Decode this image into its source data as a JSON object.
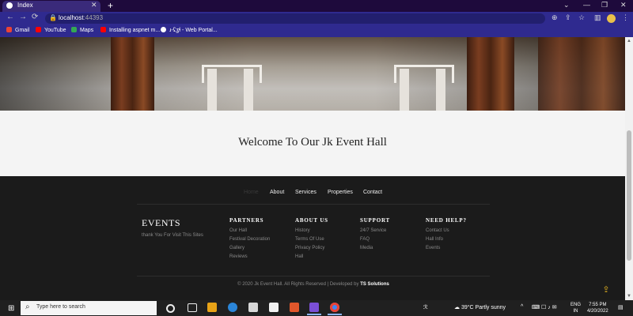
{
  "browser": {
    "tab_title": "Index",
    "tab_close": "✕",
    "new_tab": "+",
    "url_host": "localhost",
    "url_port": ":44393",
    "controls": [
      "⌄",
      "—",
      "❐",
      "✕"
    ],
    "nav": [
      "←",
      "→",
      "⟳"
    ],
    "bookmarks": [
      {
        "label": "Gmail",
        "color": "#ea4335"
      },
      {
        "label": "YouTube",
        "color": "#ff0000"
      },
      {
        "label": "Maps",
        "color": "#34a853"
      },
      {
        "label": "Installing aspnet m...",
        "color": "#ff0000"
      },
      {
        "label": "ɹ-ʢʓɬ - Web Portal...",
        "color": "#ffffff"
      }
    ]
  },
  "page": {
    "welcome": "Welcome To Our Jk Event Hall",
    "nav": [
      "Home",
      "About",
      "Services",
      "Properties",
      "Contact"
    ],
    "brand": "EVENTS",
    "tagline": "thank You For Visit This Sites",
    "columns": [
      {
        "title": "PARTNERS",
        "links": [
          "Our Hall",
          "Festival Decoration",
          "Gallery",
          "Reviews"
        ]
      },
      {
        "title": "ABOUT US",
        "links": [
          "History",
          "Terms Of Use",
          "Privacy Policy",
          "Hall"
        ]
      },
      {
        "title": "SUPPORT",
        "links": [
          "24/7 Service",
          "FAQ",
          "Media"
        ]
      },
      {
        "title": "NEED HELP?",
        "links": [
          "Contact Us",
          "Hall Info",
          "Events"
        ]
      }
    ],
    "copyright": "© 2020 Jk Event Hall. All Rights Reserved | Developed by ",
    "developer": "TS Solutions",
    "to_top": "⇪"
  },
  "taskbar": {
    "search_placeholder": "Type here to search",
    "weather": "39°C  Partly sunny",
    "lang": "ENG",
    "region": "IN",
    "time": "7:55 PM",
    "date": "4/20/2022",
    "app_colors": [
      "#eeeeee",
      "#e8a317",
      "#2b86d9",
      "#d8d8d8",
      "#e2572b",
      "#7b4fd6",
      "#f2f2f2"
    ]
  }
}
